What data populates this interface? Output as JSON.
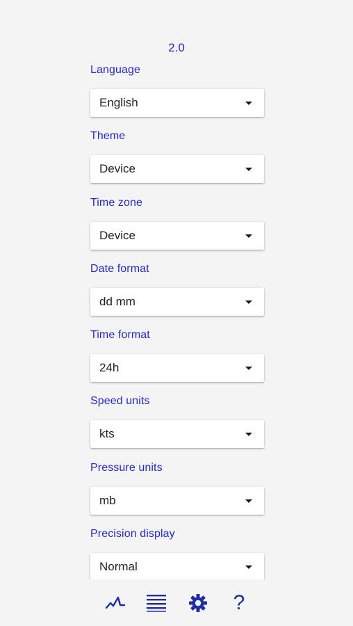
{
  "app": {
    "version": "2.0"
  },
  "colors": {
    "accent": "#2626c9",
    "icon": "#1f2ca8",
    "background": "#f4f4f4"
  },
  "settings": [
    {
      "label": "Language",
      "value": "English"
    },
    {
      "label": "Theme",
      "value": "Device"
    },
    {
      "label": "Time zone",
      "value": "Device"
    },
    {
      "label": "Date format",
      "value": "dd mm"
    },
    {
      "label": "Time format",
      "value": "24h"
    },
    {
      "label": "Speed units",
      "value": "kts"
    },
    {
      "label": "Pressure units",
      "value": "mb"
    },
    {
      "label": "Precision display",
      "value": "Normal"
    }
  ],
  "nav": {
    "items": [
      {
        "icon": "chart-line-icon"
      },
      {
        "icon": "list-icon"
      },
      {
        "icon": "gear-icon"
      },
      {
        "icon": "help-icon",
        "glyph": "?"
      }
    ]
  }
}
